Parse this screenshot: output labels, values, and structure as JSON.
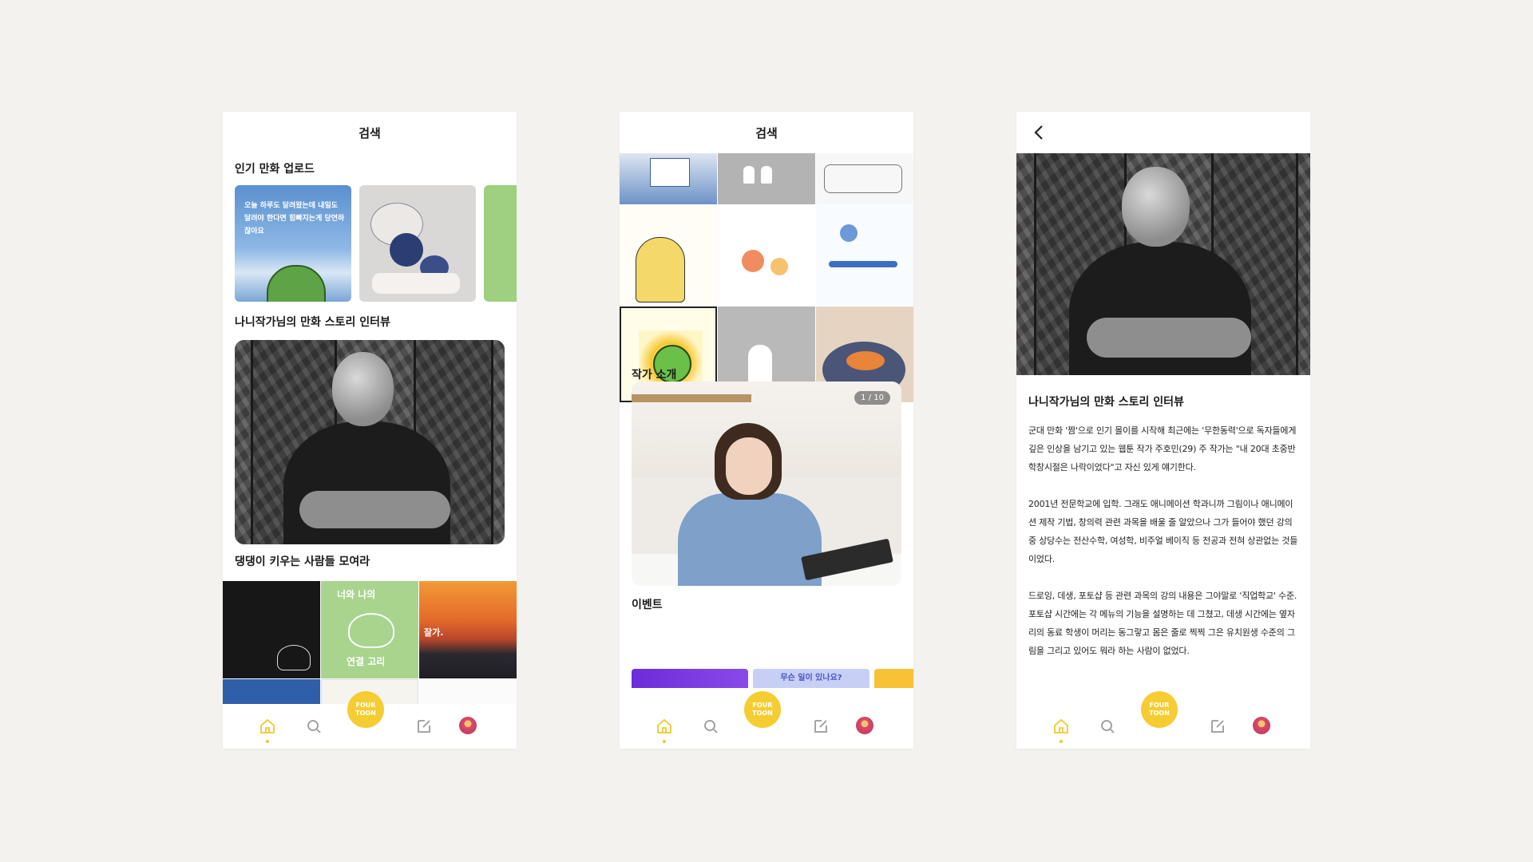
{
  "screen1": {
    "header_title": "검색",
    "section_popular": "인기 만화 업로드",
    "popular_card1_text": "오늘 하루도 달려왔는데 내일도 달려야 한다면 힘빠지는게 당연하잖아요",
    "section_interview": "나니작가님의 만화 스토리 인터뷰",
    "section_dogs": "댕댕이 키우는 사람들 모여라",
    "dog_card2_text": "너와 나의 연결 고리",
    "dog_card3_text": "잘가."
  },
  "screen2": {
    "header_title": "검색",
    "section_author": "작가 소개",
    "pager": "1 / 10",
    "section_event": "이벤트",
    "event2_text": "무슨 일이 있나요?"
  },
  "screen3": {
    "article_title": "나니작가님의 만화 스토리 인터뷰",
    "paragraphs": [
      "군대 만화 '짬'으로 인기 몰이를 시작해 최근에는 '무한동력'으로 독자들에게 깊은 인상을 남기고 있는 웹툰 작가 주호민(29) 주 작가는 \"내 20대 초중반 학창시절은 나락이었다\"고 자신 있게 얘기한다.",
      "2001년 전문학교에 입학. 그래도 애니메이션 학과니까 그림이나 애니메이션 제작 기법, 창의력 관련 과목을 배울 줄 알았으나 그가 들어야 했던 강의 중 상당수는 전산수학, 여성학, 비주얼 베이직 등 전공과 전혀 상관없는 것들이었다.",
      "드로잉, 데생, 포토샵 등 관련 과목의 강의 내용은 그야말로 '직업학교' 수준. 포토샵 시간에는 각 메뉴의 기능을 설명하는 데 그쳤고, 데생 시간에는 옆자리의 동료 학생이 머리는 동그랗고 몸은 줄로 찍찍 그은 유치원생 수준의 그림을 그리고 있어도 뭐라 하는 사람이 없었다."
    ]
  },
  "nav": {
    "fab_line1": "FOUR",
    "fab_line2": "TOON"
  },
  "colors": {
    "accent": "#f5cd32",
    "background": "#f3f2ee"
  },
  "icons": [
    "home-icon",
    "search-icon",
    "fourtoon-logo",
    "write-icon",
    "profile-avatar",
    "back-icon"
  ]
}
